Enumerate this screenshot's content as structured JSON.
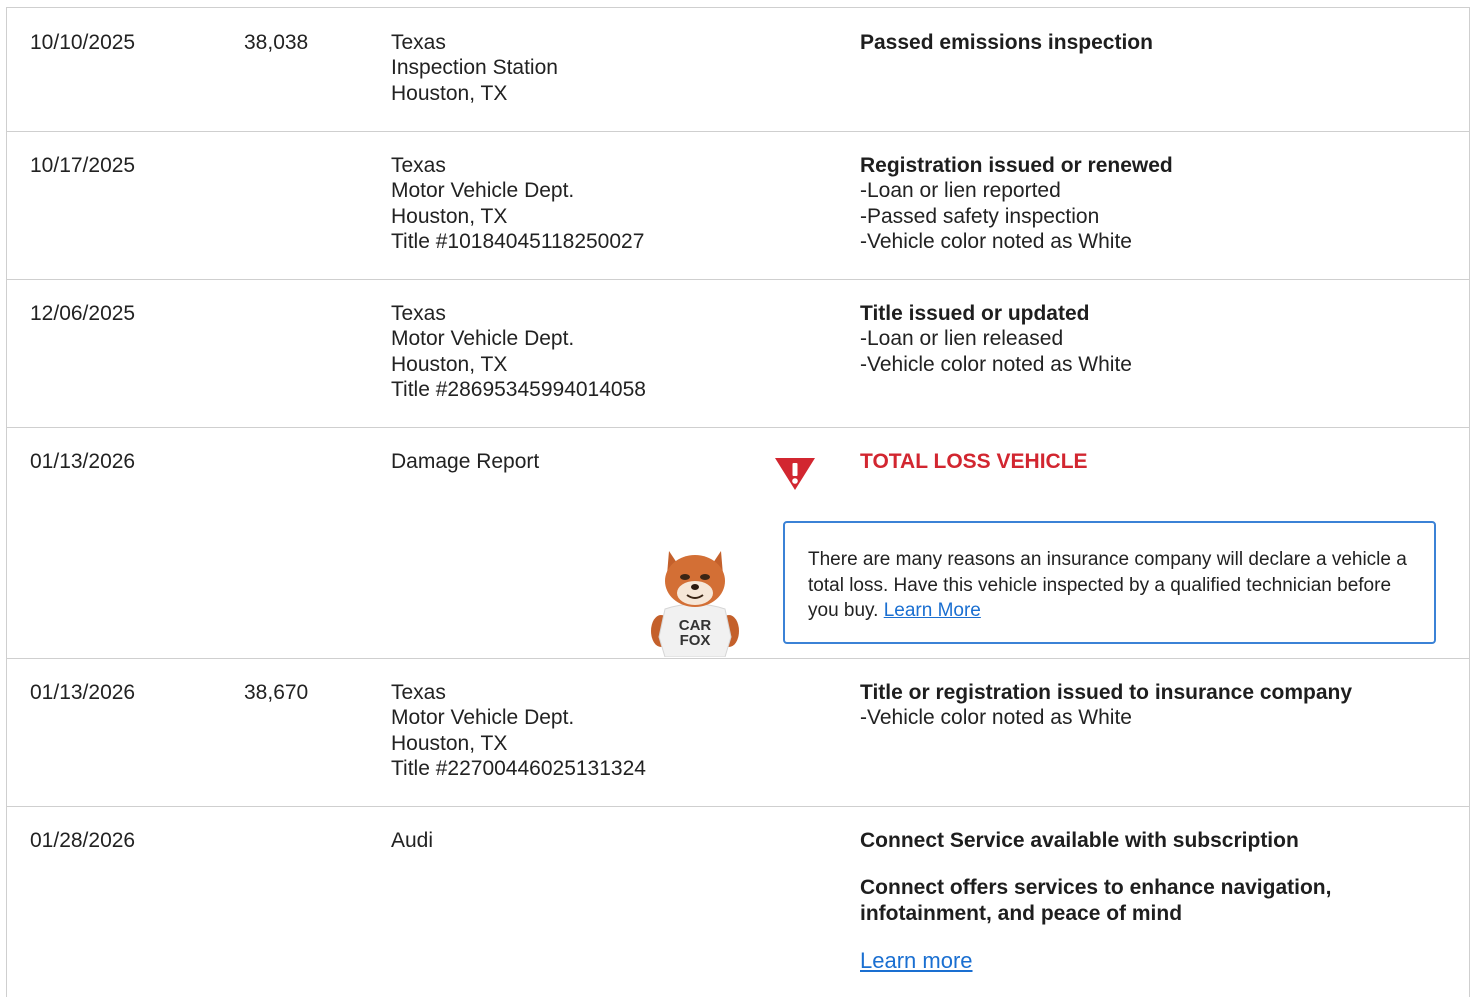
{
  "rows": [
    {
      "date": "10/10/2025",
      "odometer": "38,038",
      "source": [
        "Texas",
        "Inspection Station",
        "Houston, TX"
      ],
      "headline": "Passed emissions inspection",
      "details": []
    },
    {
      "date": "10/17/2025",
      "odometer": "",
      "source": [
        "Texas",
        "Motor Vehicle Dept.",
        "Houston, TX",
        "Title #10184045118250027"
      ],
      "headline": "Registration issued or renewed",
      "details": [
        "-Loan or lien reported",
        "-Passed safety inspection",
        "-Vehicle color noted as White"
      ]
    },
    {
      "date": "12/06/2025",
      "odometer": "",
      "source": [
        "Texas",
        "Motor Vehicle Dept.",
        "Houston, TX",
        "Title #28695345994014058"
      ],
      "headline": "Title issued or updated",
      "details": [
        "-Loan or lien released",
        "-Vehicle color noted as White"
      ]
    },
    {
      "date": "01/13/2026",
      "odometer": "",
      "source": [
        "Damage Report"
      ],
      "headline": "TOTAL LOSS VEHICLE",
      "callout_text": "There are many reasons an insurance company will declare a vehicle a total loss. Have this vehicle inspected by a qualified technician before you buy.",
      "callout_link": "Learn More",
      "mascot_shirt": [
        "CAR",
        "FOX"
      ]
    },
    {
      "date": "01/13/2026",
      "odometer": "38,670",
      "source": [
        "Texas",
        "Motor Vehicle Dept.",
        "Houston, TX",
        "Title #22700446025131324"
      ],
      "headline": "Title or registration issued to insurance company",
      "details": [
        "-Vehicle color noted as White"
      ]
    },
    {
      "date": "01/28/2026",
      "odometer": "",
      "source": [
        "Audi"
      ],
      "headline": "Connect Service available with subscription",
      "subheadline": [
        "Connect offers services to enhance navigation,",
        "infotainment, and peace of mind"
      ],
      "link": "Learn more"
    }
  ],
  "colors": {
    "alert": "#d22630",
    "link": "#1a6fd1",
    "callout_border": "#3b82d6",
    "divider": "#cfcfcf"
  },
  "icons": {
    "warning": "warning-triangle-icon",
    "mascot": "carfox-mascot-icon"
  }
}
